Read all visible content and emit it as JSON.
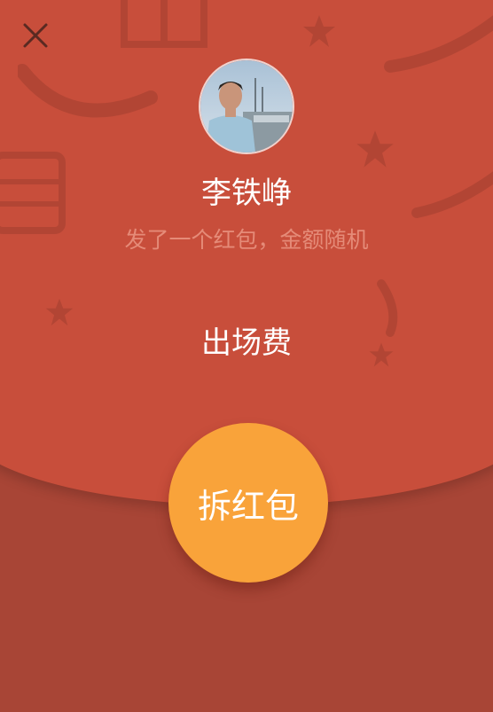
{
  "header": {
    "close_icon": "close-icon"
  },
  "sender": {
    "name": "李铁峥",
    "subtitle": "发了一个红包，金额随机"
  },
  "envelope": {
    "message": "出场费",
    "open_label": "拆红包"
  },
  "colors": {
    "top_panel": "#c84e3b",
    "bottom_panel": "#a84536",
    "open_button": "#f9a33a",
    "subtitle_text": "#e58b78"
  }
}
